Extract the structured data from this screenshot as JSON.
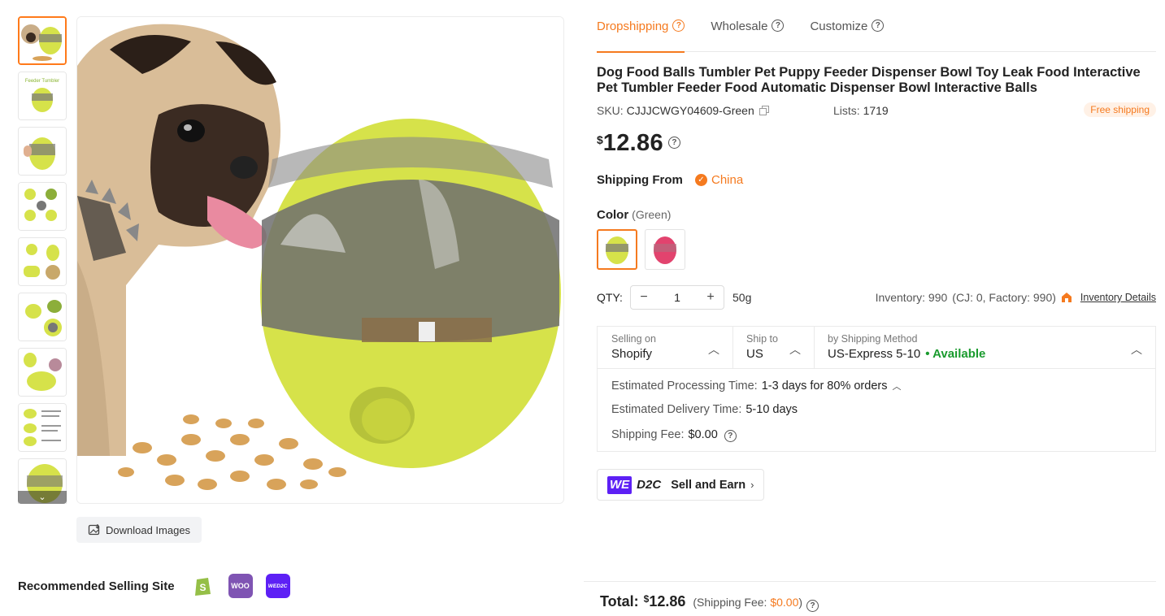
{
  "thumbnails": [
    {
      "alt": "pug-with-green-egg"
    },
    {
      "alt": "feeder-tumbler-banner",
      "caption": "Feeder Tumbler"
    },
    {
      "alt": "hand-holding-feeder"
    },
    {
      "alt": "feeder-grid"
    },
    {
      "alt": "feeder-parts"
    },
    {
      "alt": "feeder-in-use"
    },
    {
      "alt": "feeder-details"
    },
    {
      "alt": "feeder-size-chart"
    },
    {
      "alt": "feeder-partial"
    }
  ],
  "download_label": "Download Images",
  "recommended": {
    "label": "Recommended Selling Site",
    "sites": [
      {
        "name": "shopify-logo",
        "color": "#e8f5e2"
      },
      {
        "name": "woocommerce-logo",
        "color": "#7f54b3",
        "text": "WOO"
      },
      {
        "name": "wed2c-logo",
        "color": "#5d20f5",
        "text": "WED2C"
      }
    ]
  },
  "tabs": [
    {
      "label": "Dropshipping",
      "active": true
    },
    {
      "label": "Wholesale",
      "active": false
    },
    {
      "label": "Customize",
      "active": false
    }
  ],
  "product": {
    "title": "Dog Food Balls Tumbler Pet Puppy Feeder Dispenser Bowl Toy Leak Food Interactive Pet Tumbler Feeder Food Automatic Dispenser Bowl Interactive Balls",
    "sku_label": "SKU:",
    "sku": "CJJJCWGY04609-Green",
    "lists_label": "Lists:",
    "lists": "1719",
    "free_shipping": "Free shipping",
    "currency": "$",
    "price": "12.86",
    "shipping_from_label": "Shipping From",
    "shipping_from": "China",
    "color_label": "Color",
    "color_value": "(Green)",
    "colors": [
      {
        "name": "Green",
        "hex": "#d6e24a",
        "active": true
      },
      {
        "name": "Pink",
        "hex": "#e2436e",
        "active": false
      }
    ],
    "qty_label": "QTY:",
    "qty": "1",
    "weight": "50g",
    "inventory": "Inventory: 990",
    "inventory_detail": "(CJ: 0, Factory: 990)",
    "inventory_link": "Inventory Details"
  },
  "shipping": {
    "selling_on_label": "Selling on",
    "selling_on": "Shopify",
    "ship_to_label": "Ship to",
    "ship_to": "US",
    "method_label": "by Shipping Method",
    "method": "US-Express 5-10",
    "method_status": "• Available",
    "processing_label": "Estimated Processing Time:",
    "processing": "1-3 days for 80% orders",
    "delivery_label": "Estimated Delivery Time:",
    "delivery": "5-10 days",
    "fee_label": "Shipping Fee:",
    "fee": "$0.00"
  },
  "d2c": {
    "we": "WE",
    "d2c": "D2C",
    "label": "Sell and Earn"
  },
  "total": {
    "label": "Total:",
    "currency": "$",
    "amount": "12.86",
    "fee_prefix": "(Shipping Fee:",
    "fee": "$0.00",
    "fee_suffix": ")"
  },
  "colors": {
    "accent": "#f57a1f",
    "available": "#1a9b2e",
    "product_green": "#d6e24a"
  }
}
